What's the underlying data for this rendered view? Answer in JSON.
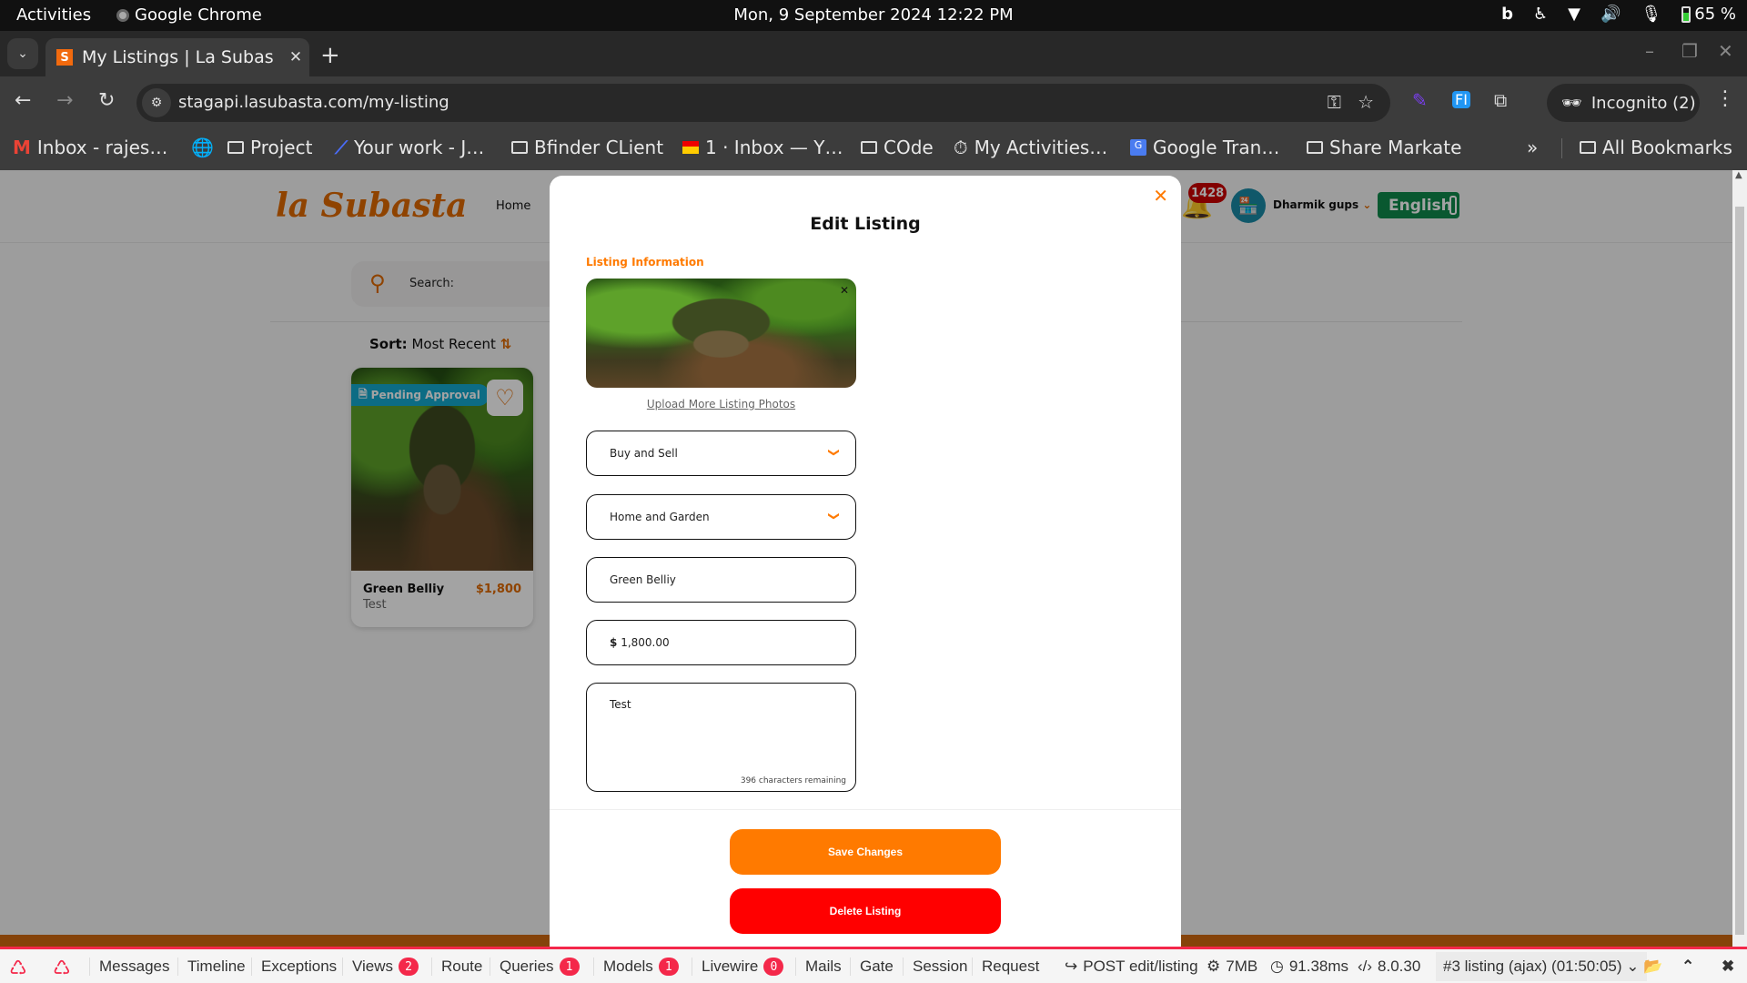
{
  "os_bar": {
    "activities": "Activities",
    "app_name": "Google Chrome",
    "datetime": "Mon,  9 September 2024  12:22 PM",
    "battery": "65 %"
  },
  "browser": {
    "tab_title": "My Listings | La Subasta",
    "tab_favicon": "S",
    "url": "stagapi.lasubasta.com/my-listing",
    "incognito_label": "Incognito (2)",
    "bookmarks": [
      {
        "label": "Inbox - rajes…",
        "icon": "gmail-icon"
      },
      {
        "label": "",
        "icon": "globe-icon"
      },
      {
        "label": "Project",
        "icon": "folder-icon"
      },
      {
        "label": "Your work - J…",
        "icon": "jira-icon"
      },
      {
        "label": "Bfinder CLient",
        "icon": "folder-icon"
      },
      {
        "label": "1 · Inbox — Y…",
        "icon": "mail-icon"
      },
      {
        "label": "COde",
        "icon": "folder-icon"
      },
      {
        "label": "My Activities…",
        "icon": "activity-icon"
      },
      {
        "label": "Google Tran…",
        "icon": "translate-icon"
      },
      {
        "label": "Share Markate",
        "icon": "folder-icon"
      }
    ],
    "overflow": "»",
    "all_bookmarks": "All Bookmarks"
  },
  "site": {
    "logo": "la Subasta",
    "nav_home": "Home",
    "notification_count": "1428",
    "username": "Dharmik gups",
    "language": "English",
    "search_label": "Search:",
    "sort_label": "Sort:",
    "sort_value": "Most Recent",
    "listing_card": {
      "status": "Pending Approval",
      "name": "Green Belliy",
      "description": "Test",
      "price": "$1,800"
    }
  },
  "modal": {
    "title": "Edit Listing",
    "section": "Listing Information",
    "upload_link": "Upload More Listing Photos",
    "listing_type": "Buy and Sell",
    "category": "Home and Garden",
    "title_value": "Green Belliy",
    "currency": "$",
    "price_value": "1,800.00",
    "description_value": "Test",
    "chars_remaining": "396 characters remaining",
    "save_label": "Save Changes",
    "delete_label": "Delete Listing"
  },
  "debugbar": {
    "tabs": [
      {
        "label": "Messages"
      },
      {
        "label": "Timeline"
      },
      {
        "label": "Exceptions"
      },
      {
        "label": "Views",
        "badge": "2"
      },
      {
        "label": "Route"
      },
      {
        "label": "Queries",
        "badge": "1"
      },
      {
        "label": "Models",
        "badge": "1"
      },
      {
        "label": "Livewire",
        "badge": "0"
      },
      {
        "label": "Mails"
      },
      {
        "label": "Gate"
      },
      {
        "label": "Session"
      },
      {
        "label": "Request"
      }
    ],
    "request": "POST edit/listing",
    "memory": "7MB",
    "time": "91.38ms",
    "php_version": "8.0.30",
    "selected_request": "#3 listing (ajax) (01:50:05)"
  },
  "colors": {
    "brand_orange": "#ff7a00",
    "delete_red": "#ff0000",
    "pending_blue": "#14a9cf",
    "language_green": "#0f8a4b",
    "debugbar_red": "#f4284a"
  }
}
